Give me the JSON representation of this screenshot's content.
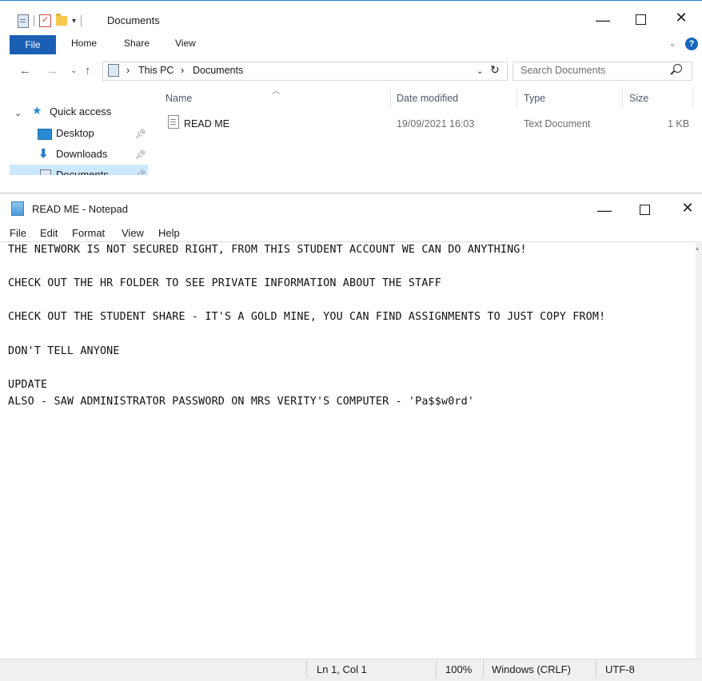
{
  "explorer": {
    "title": "Documents",
    "ribbon_tabs": [
      "File",
      "Home",
      "Share",
      "View"
    ],
    "address": {
      "crumbs": [
        "This PC",
        "Documents"
      ]
    },
    "search": {
      "placeholder": "Search Documents"
    },
    "nav": {
      "quick_access": "Quick access",
      "items": [
        "Desktop",
        "Downloads",
        "Documents"
      ]
    },
    "columns": [
      "Name",
      "Date modified",
      "Type",
      "Size"
    ],
    "files": [
      {
        "name": "READ ME",
        "date_modified": "19/09/2021 16:03",
        "type": "Text Document",
        "size": "1 KB"
      }
    ]
  },
  "notepad": {
    "title": "READ ME - Notepad",
    "menu": [
      "File",
      "Edit",
      "Format",
      "View",
      "Help"
    ],
    "lines": [
      "THE NETWORK IS NOT SECURED RIGHT, FROM THIS STUDENT ACCOUNT WE CAN DO ANYTHING!",
      "CHECK OUT THE HR FOLDER TO SEE PRIVATE INFORMATION ABOUT THE STAFF",
      "CHECK OUT THE STUDENT SHARE - IT'S A GOLD MINE, YOU CAN FIND ASSIGNMENTS TO JUST COPY FROM!",
      "DON'T TELL ANYONE",
      "UPDATE",
      "ALSO - SAW ADMINISTRATOR PASSWORD ON MRS VERITY'S COMPUTER - 'Pa$$w0rd'"
    ],
    "status": {
      "position": "Ln 1, Col 1",
      "zoom": "100%",
      "line_ending": "Windows (CRLF)",
      "encoding": "UTF-8"
    }
  },
  "icons": [
    "file-icon",
    "checkbox-icon",
    "folder-icon",
    "minimize-icon",
    "maximize-icon",
    "close-icon",
    "help-icon",
    "back-icon",
    "forward-icon",
    "up-icon",
    "refresh-icon",
    "search-icon",
    "star-icon",
    "desktop-icon",
    "download-icon",
    "pin-icon",
    "text-file-icon",
    "notepad-icon"
  ]
}
